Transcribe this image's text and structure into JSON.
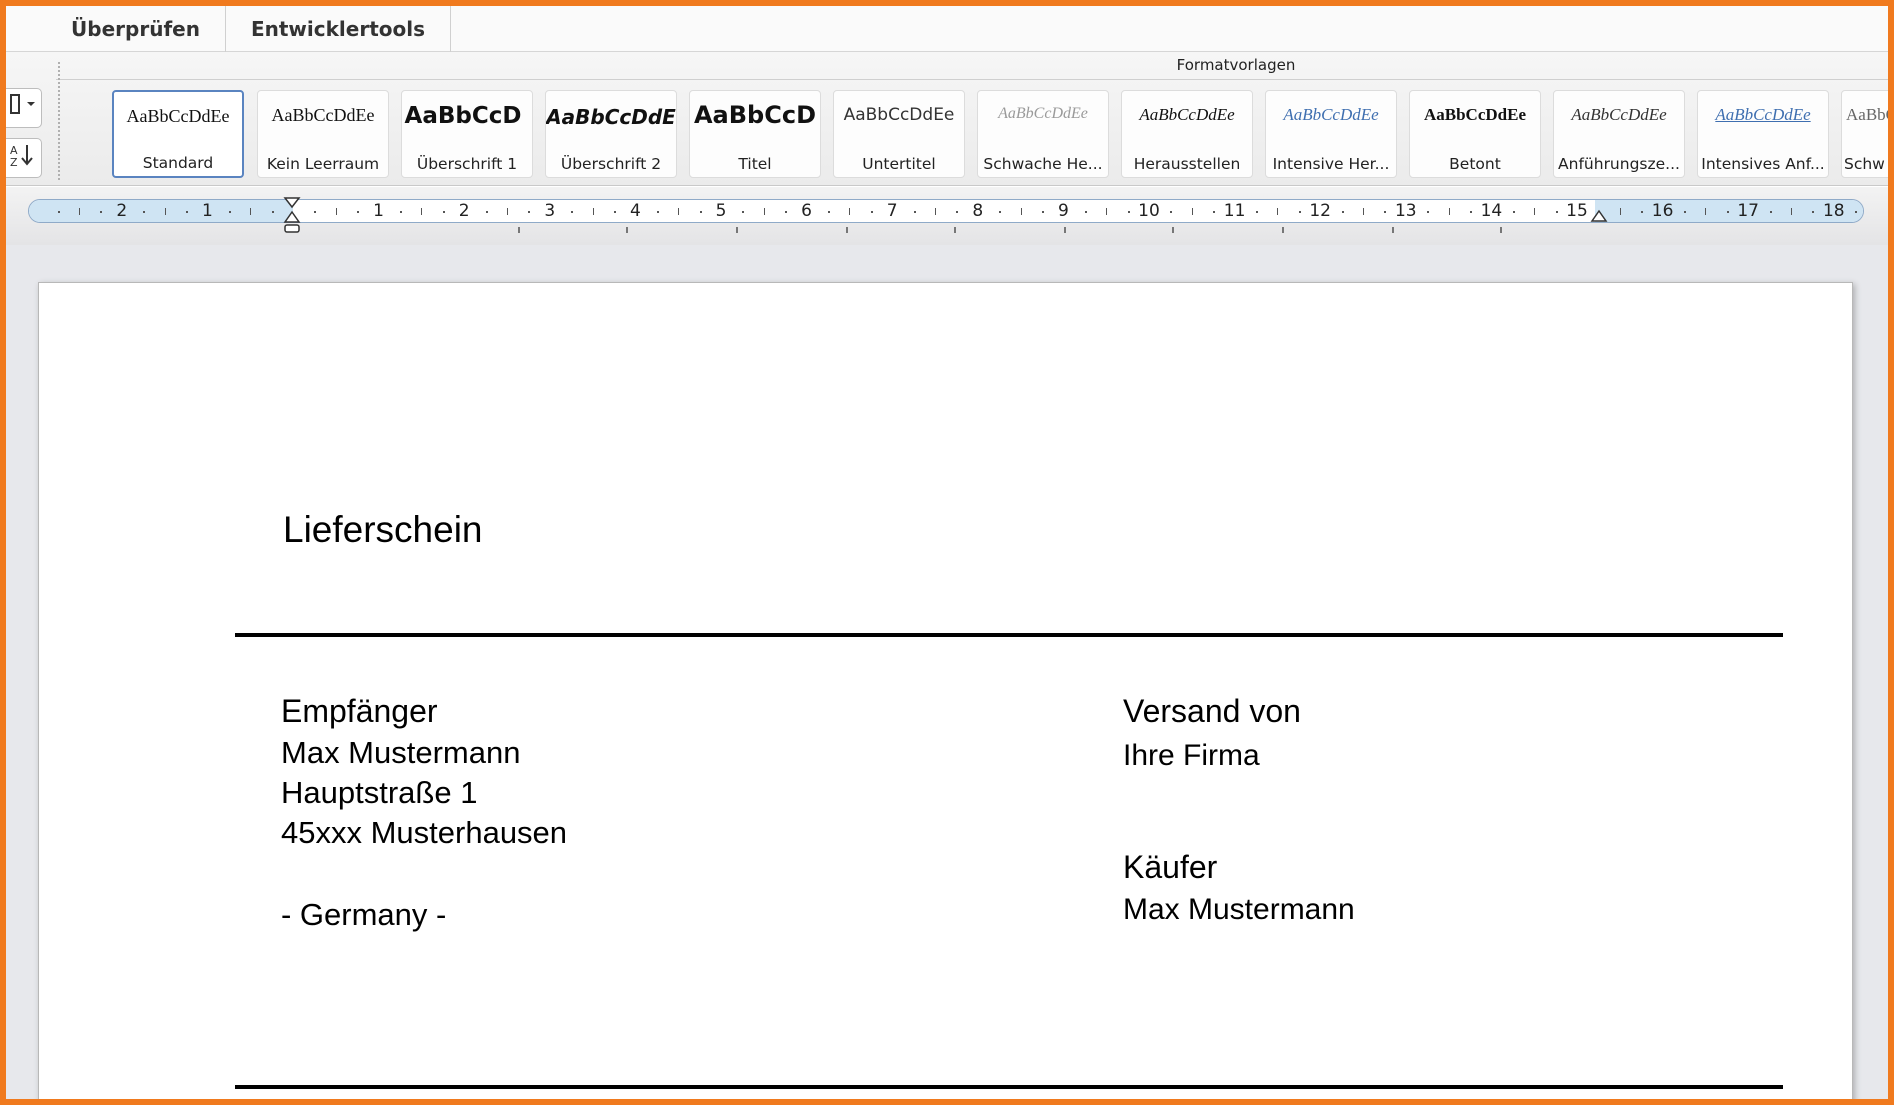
{
  "tabs": [
    "Überprüfen",
    "Entwicklertools"
  ],
  "ribbon": {
    "group_title": "Formatvorlagen",
    "styles": [
      {
        "sample": "AaBbCcDdEe",
        "label": "Standard",
        "selected": true
      },
      {
        "sample": "AaBbCcDdEe",
        "label": "Kein Leerraum"
      },
      {
        "sample": "AaBbCcD ",
        "label": "Überschrift 1"
      },
      {
        "sample": "AaBbCcDdE",
        "label": "Überschrift 2"
      },
      {
        "sample": "AaBbCcD",
        "label": "Titel"
      },
      {
        "sample": "AaBbCcDdEe",
        "label": "Untertitel"
      },
      {
        "sample": "AaBbCcDdEe",
        "label": "Schwache He..."
      },
      {
        "sample": "AaBbCcDdEe",
        "label": "Herausstellen"
      },
      {
        "sample": "AaBbCcDdEe",
        "label": "Intensive Her..."
      },
      {
        "sample": "AaBbCcDdEe",
        "label": "Betont"
      },
      {
        "sample": "AaBbCcDdEe",
        "label": "Anführungsze..."
      },
      {
        "sample": "AaBbCcDdEe",
        "label": "Intensives Anf..."
      },
      {
        "sample": "AaBbC",
        "label": "Schw"
      }
    ]
  },
  "ruler": {
    "left_numbers": [
      "2",
      "1"
    ],
    "right_numbers": [
      "1",
      "2",
      "3",
      "4",
      "5",
      "6",
      "7",
      "8",
      "9",
      "10",
      "11",
      "12",
      "13",
      "14",
      "15",
      "16",
      "17",
      "18"
    ]
  },
  "document": {
    "title": "Lieferschein",
    "recipient": {
      "heading": "Empfänger",
      "name": "Max Mustermann",
      "street": "Hauptstraße 1",
      "city": "45xxx Musterhausen",
      "country": "- Germany -"
    },
    "shipper": {
      "heading": "Versand von",
      "company": "Ihre Firma"
    },
    "buyer": {
      "heading": "Käufer",
      "name": "Max Mustermann"
    }
  }
}
